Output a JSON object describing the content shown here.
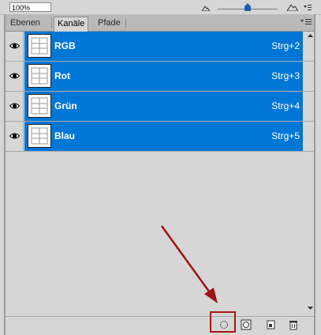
{
  "zoom": {
    "value": "100%",
    "slider_level_percent": 45
  },
  "tabs": [
    {
      "label": "Ebenen",
      "active": false
    },
    {
      "label": "Kanäle",
      "active": true
    },
    {
      "label": "Pfade",
      "active": false
    }
  ],
  "channels": [
    {
      "name": "RGB",
      "shortcut": "Strg+2",
      "visible": true,
      "selected": true
    },
    {
      "name": "Rot",
      "shortcut": "Strg+3",
      "visible": true,
      "selected": true
    },
    {
      "name": "Grün",
      "shortcut": "Strg+4",
      "visible": true,
      "selected": true
    },
    {
      "name": "Blau",
      "shortcut": "Strg+5",
      "visible": true,
      "selected": true
    }
  ],
  "bottom_toolbar": [
    "load-channel-as-selection-icon",
    "save-selection-as-channel-icon",
    "new-channel-icon",
    "trash-icon"
  ],
  "colors": {
    "selection": "#0076d6",
    "panel_bg": "#d6d6d6",
    "highlight": "#a81818"
  }
}
